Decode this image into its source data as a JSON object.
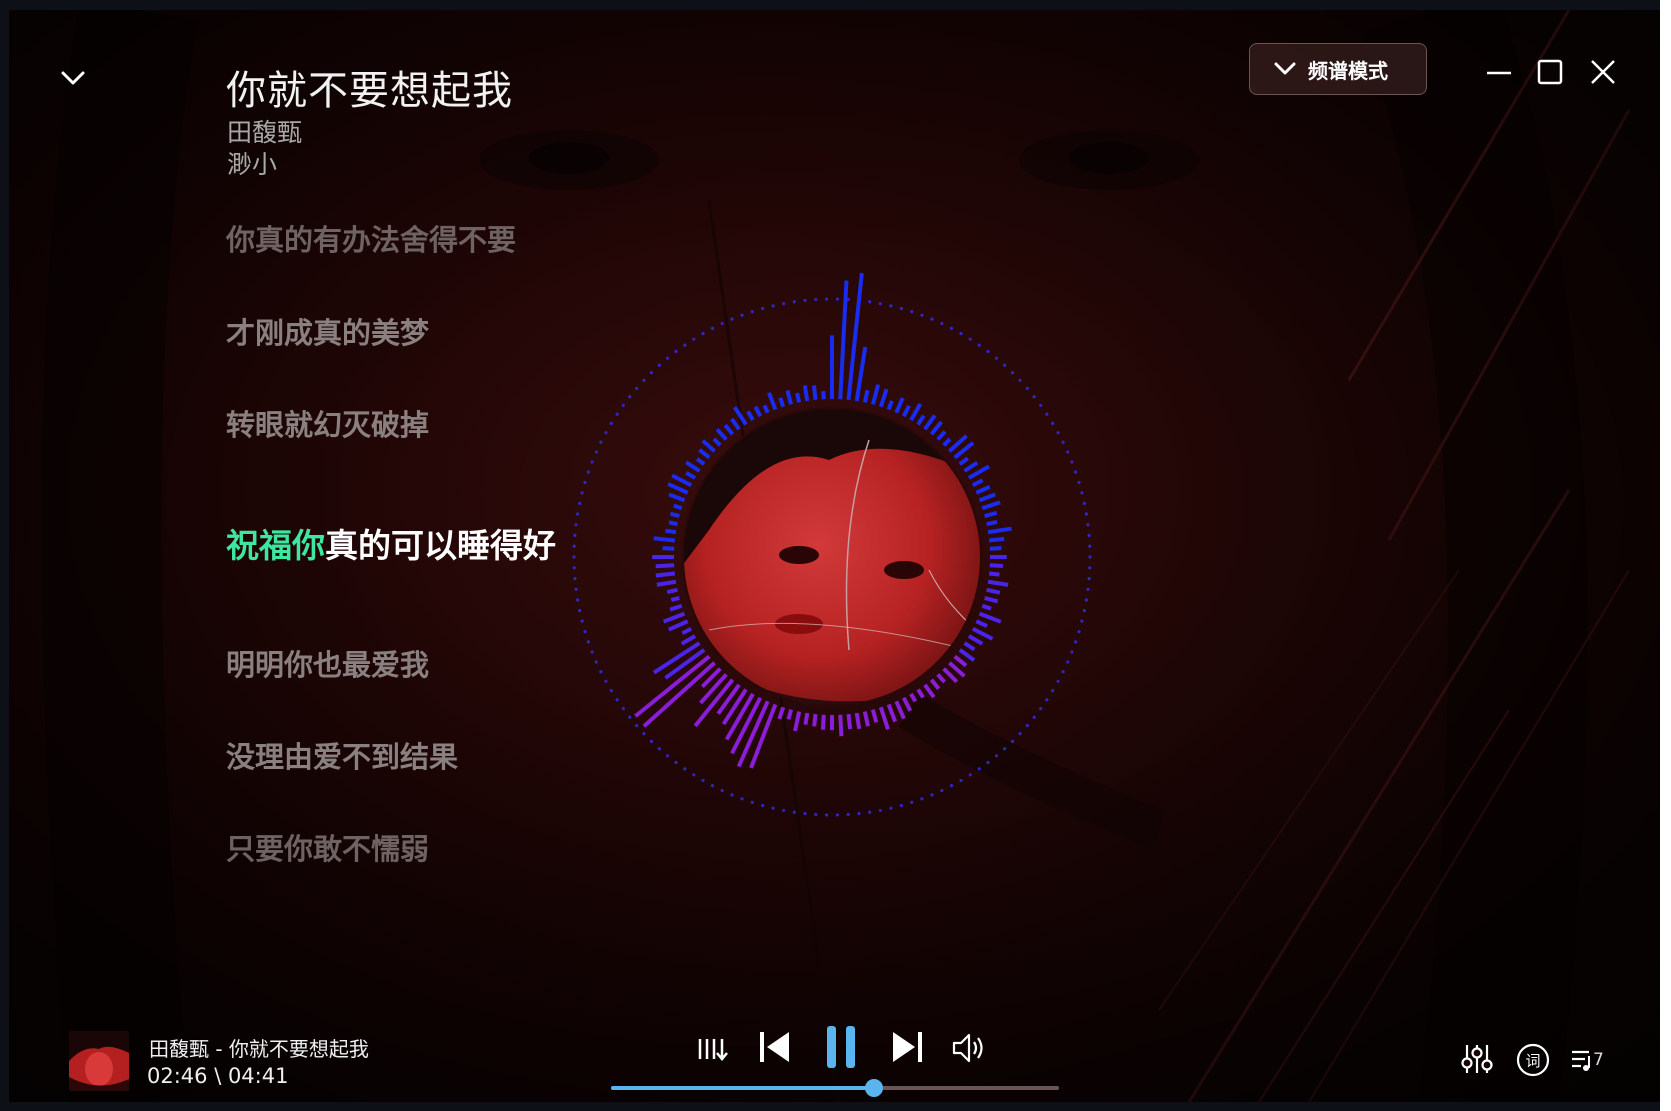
{
  "song": {
    "title": "你就不要想起我",
    "artist": "田馥甄",
    "album": "渺小"
  },
  "header": {
    "mode_label": "频谱模式"
  },
  "lyrics": [
    {
      "text": "你真的有办法舍得不要",
      "state": "dim"
    },
    {
      "text": "才刚成真的美梦",
      "state": "normal"
    },
    {
      "text": "转眼就幻灭破掉",
      "state": "normal"
    },
    {
      "text": "真的可以睡得好",
      "highlight": "祝福你",
      "state": "active"
    },
    {
      "text": "明明你也最爱我",
      "state": "normal"
    },
    {
      "text": "没理由爱不到结果",
      "state": "normal"
    },
    {
      "text": "只要你敢不懦弱",
      "state": "dim"
    }
  ],
  "now_playing": {
    "title_line": "田馥甄 - 你就不要想起我",
    "time_line": "02:46 \\ 04:41",
    "progress": 0.586
  },
  "controls": {
    "queue_count": "7"
  },
  "icons": [
    "chevron-down-icon",
    "minimize-icon",
    "maximize-icon",
    "close-icon",
    "equalizer-mode-icon",
    "previous-icon",
    "pause-icon",
    "next-icon",
    "volume-icon",
    "sound-effects-icon",
    "lyrics-icon",
    "playlist-icon"
  ],
  "colors": {
    "accent": "#5ab4ee",
    "lyric_highlight": "#3ee6a0",
    "spectrum_start": "#1a2cf0",
    "spectrum_end": "#8a1ed8"
  }
}
